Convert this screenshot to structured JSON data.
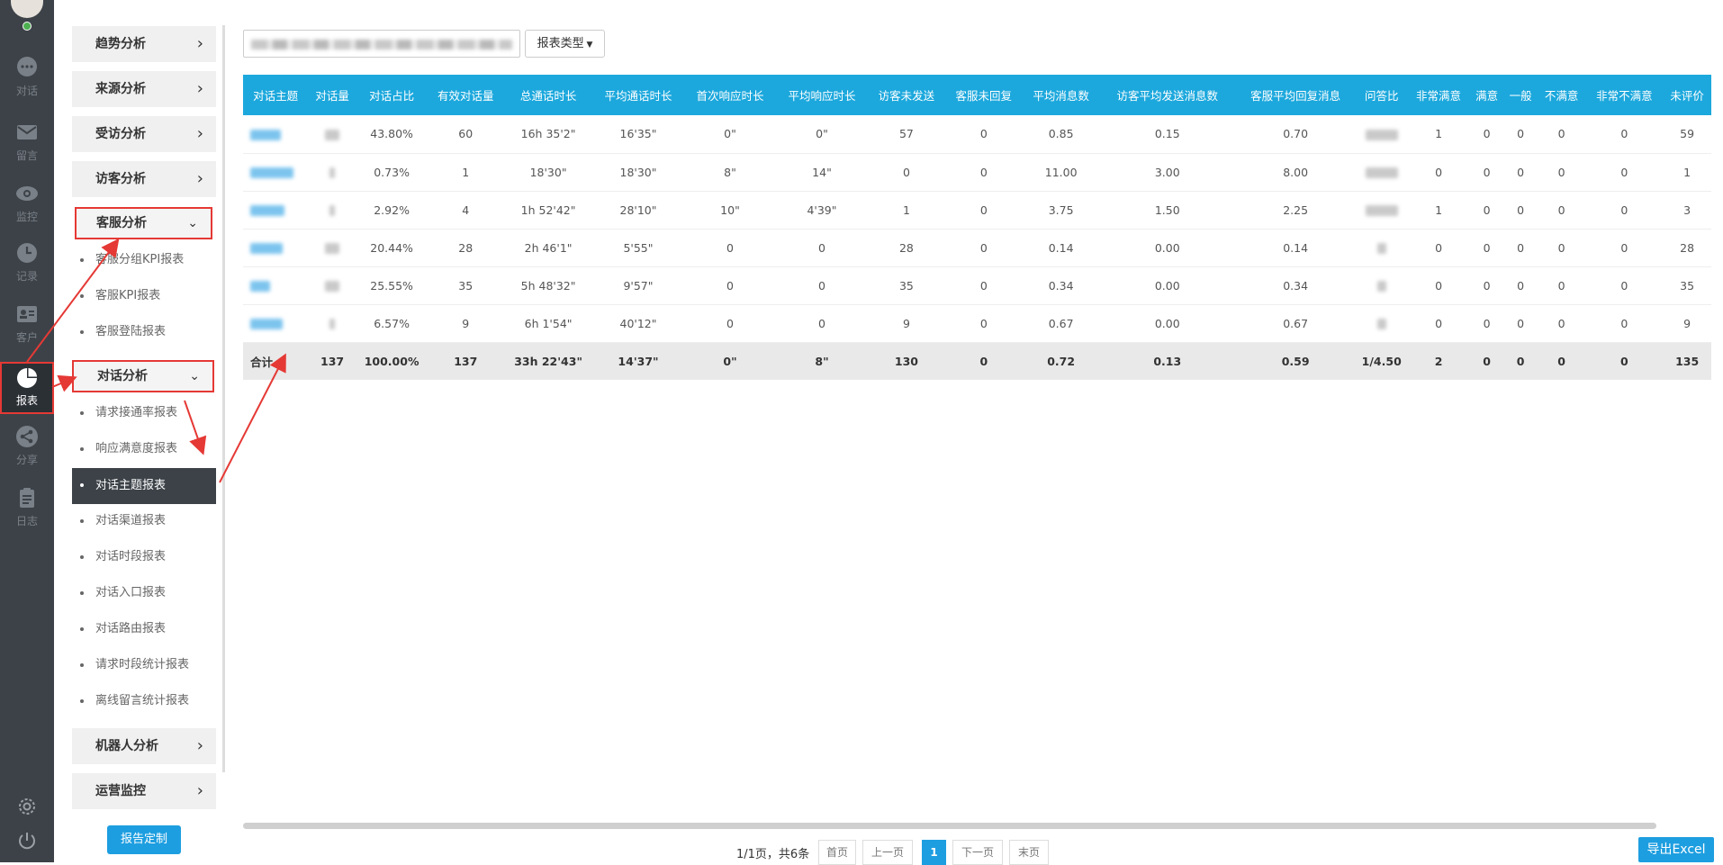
{
  "rail": {
    "items": [
      {
        "label": "对话",
        "icon": "chat-bubble-icon"
      },
      {
        "label": "留言",
        "icon": "envelope-icon"
      },
      {
        "label": "监控",
        "icon": "eye-icon"
      },
      {
        "label": "记录",
        "icon": "clock-icon"
      },
      {
        "label": "客户",
        "icon": "contact-card-icon"
      },
      {
        "label": "报表",
        "icon": "pie-chart-icon"
      },
      {
        "label": "分享",
        "icon": "share-icon"
      },
      {
        "label": "日志",
        "icon": "clipboard-icon"
      }
    ]
  },
  "submenu": {
    "groups": {
      "trend": "趋势分析",
      "source": "来源分析",
      "visited": "受访分析",
      "visitor": "访客分析",
      "agent": "客服分析",
      "dialog": "对话分析",
      "robot": "机器人分析",
      "ops": "运营监控"
    },
    "agent_items": [
      "客服分组KPI报表",
      "客服KPI报表",
      "客服登陆报表"
    ],
    "dialog_items": [
      "请求接通率报表",
      "响应满意度报表",
      "对话主题报表",
      "对话渠道报表",
      "对话时段报表",
      "对话入口报表",
      "对话路由报表",
      "请求时段统计报表",
      "离线留言统计报表"
    ],
    "custom_button": "报告定制"
  },
  "toolbar": {
    "type_button": "报表类型"
  },
  "table": {
    "headers": [
      "对话主题",
      "对话量",
      "对话占比",
      "有效对话量",
      "总通话时长",
      "平均通话时长",
      "首次响应时长",
      "平均响应时长",
      "访客未发送",
      "客服未回复",
      "平均消息数",
      "访客平均发送消息数",
      "客服平均回复消息",
      "问答比",
      "非常满意",
      "满意",
      "一般",
      "不满意",
      "非常不满意",
      "未评价"
    ],
    "rows": [
      [
        "43.80%",
        "60",
        "16h 35'2\"",
        "16'35\"",
        "0\"",
        "0\"",
        "57",
        "0",
        "0.85",
        "0.15",
        "0.70",
        "1",
        "0",
        "0",
        "0",
        "0",
        "59"
      ],
      [
        "0.73%",
        "1",
        "18'30\"",
        "18'30\"",
        "8\"",
        "14\"",
        "0",
        "0",
        "11.00",
        "3.00",
        "8.00",
        "0",
        "0",
        "0",
        "0",
        "0",
        "1"
      ],
      [
        "2.92%",
        "4",
        "1h 52'42\"",
        "28'10\"",
        "10\"",
        "4'39\"",
        "1",
        "0",
        "3.75",
        "1.50",
        "2.25",
        "1",
        "0",
        "0",
        "0",
        "0",
        "3"
      ],
      [
        "20.44%",
        "28",
        "2h 46'1\"",
        "5'55\"",
        "0",
        "0",
        "28",
        "0",
        "0.14",
        "0.00",
        "0.14",
        "0",
        "0",
        "0",
        "0",
        "0",
        "28"
      ],
      [
        "25.55%",
        "35",
        "5h 48'32\"",
        "9'57\"",
        "0",
        "0",
        "35",
        "0",
        "0.34",
        "0.00",
        "0.34",
        "0",
        "0",
        "0",
        "0",
        "0",
        "35"
      ],
      [
        "6.57%",
        "9",
        "6h 1'54\"",
        "40'12\"",
        "0",
        "0",
        "9",
        "0",
        "0.67",
        "0.00",
        "0.67",
        "0",
        "0",
        "0",
        "0",
        "0",
        "9"
      ]
    ],
    "total": [
      "合计",
      "137",
      "100.00%",
      "137",
      "33h 22'43\"",
      "14'37\"",
      "0\"",
      "8\"",
      "130",
      "0",
      "0.72",
      "0.13",
      "0.59",
      "1/4.50",
      "2",
      "0",
      "0",
      "0",
      "0",
      "135"
    ]
  },
  "pager": {
    "info": "1/1页，共6条",
    "first": "首页",
    "prev": "上一页",
    "current": "1",
    "next": "下一页",
    "last": "末页"
  },
  "export_button": "导出Excel",
  "colors": {
    "accent": "#1ca8dd",
    "rail": "#3c4248",
    "highlight": "#e53935"
  }
}
